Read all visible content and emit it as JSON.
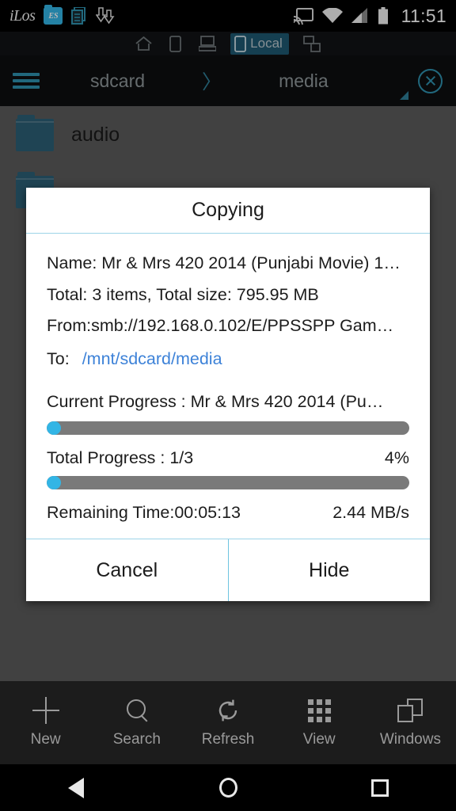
{
  "status_bar": {
    "app_logo_text": "iLos",
    "es_icon_text": "ES",
    "time": "11:51",
    "icons": [
      "ilos-logo-icon",
      "es-file-explorer-icon",
      "copy-notification-icon",
      "download-arrows-icon",
      "cast-icon",
      "wifi-icon",
      "cellular-signal-icon",
      "battery-icon"
    ]
  },
  "tab_strip": {
    "tabs": [
      {
        "id": "home",
        "icon": "home-icon",
        "label": "",
        "active": false
      },
      {
        "id": "device",
        "icon": "phone-icon",
        "label": "",
        "active": false
      },
      {
        "id": "computer",
        "icon": "computer-icon",
        "label": "",
        "active": false
      },
      {
        "id": "local",
        "icon": "tablet-icon",
        "label": "Local",
        "active": true
      },
      {
        "id": "network",
        "icon": "network-icon",
        "label": "",
        "active": false
      }
    ]
  },
  "path_bar": {
    "menu_icon": "hamburger-menu-icon",
    "crumbs": [
      "sdcard",
      "media"
    ],
    "separator": "〉",
    "close_icon": "close-circle-icon",
    "sort_handle": "resize-handle-icon"
  },
  "file_list": {
    "rows": [
      {
        "icon": "folder-icon",
        "name": "audio"
      },
      {
        "icon": "folder-icon",
        "name": ""
      }
    ]
  },
  "dialog": {
    "title": "Copying",
    "name_line": "Name: Mr & Mrs 420 2014 (Punjabi Movie) 1…",
    "total_line": "Total: 3 items, Total size: 795.95 MB",
    "from_line": "From:smb://192.168.0.102/E/PPSSPP Gam…",
    "to_label": "To:",
    "to_path": "/mnt/sdcard/media",
    "current_progress_label": "Current Progress : Mr & Mrs 420 2014 (Pu…",
    "current_progress_percent": 4,
    "total_progress_label": "Total Progress : 1/3",
    "total_progress_percent_text": "4%",
    "total_progress_percent": 4,
    "remaining_time": "Remaining Time:00:05:13",
    "speed": "2.44 MB/s",
    "buttons": {
      "cancel": "Cancel",
      "hide": "Hide"
    }
  },
  "bottom_bar": {
    "items": [
      {
        "icon": "plus-icon",
        "label": "New"
      },
      {
        "icon": "search-icon",
        "label": "Search"
      },
      {
        "icon": "refresh-icon",
        "label": "Refresh"
      },
      {
        "icon": "grid-view-icon",
        "label": "View"
      },
      {
        "icon": "windows-icon",
        "label": "Windows"
      }
    ]
  },
  "nav_bar": {
    "back": "back-triangle-icon",
    "home": "home-circle-icon",
    "recent": "recent-square-icon"
  },
  "colors": {
    "accent_blue": "#33b5e5",
    "link_blue": "#3d82d8",
    "tab_active_bg": "#1e5871",
    "folder_blue": "#2b5f75",
    "track_gray": "#7a7a7a"
  }
}
